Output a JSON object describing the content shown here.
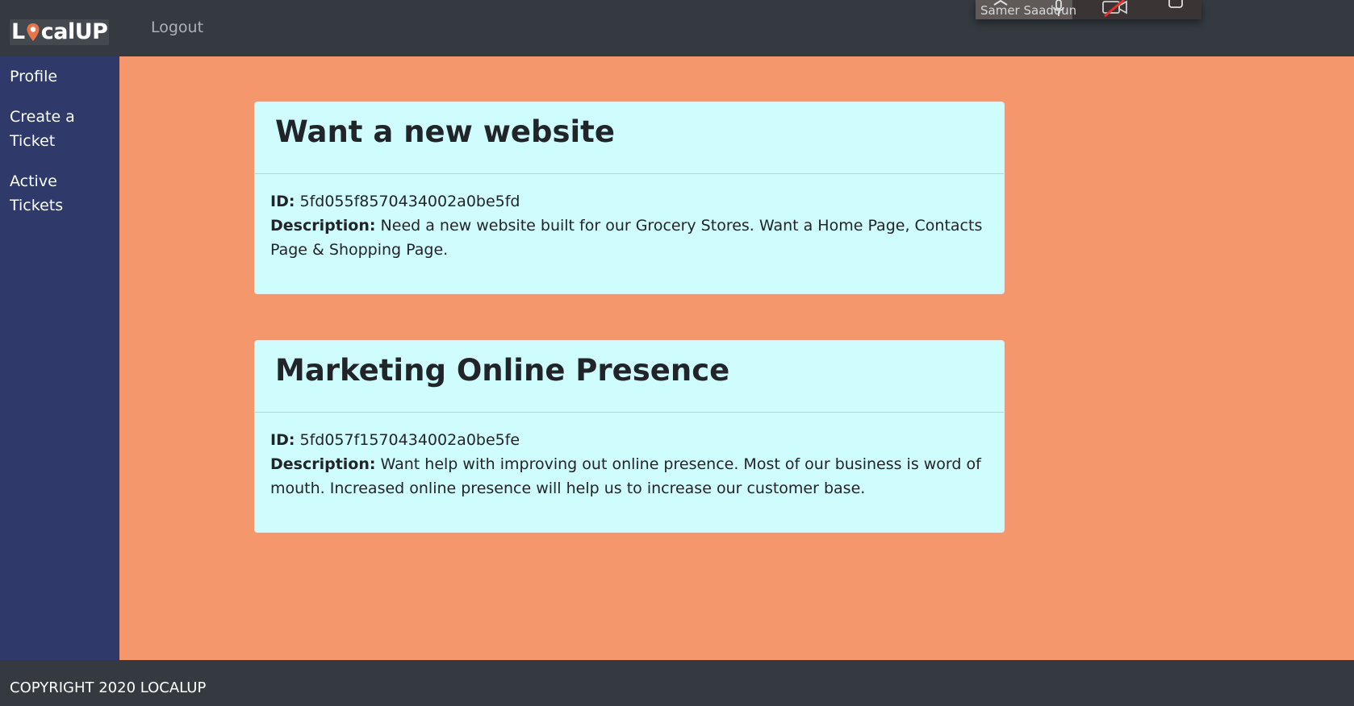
{
  "navbar": {
    "brand": "LocalUP",
    "logout_label": "Logout"
  },
  "video_overlay": {
    "participant_name": "Samer Saadoun"
  },
  "sidebar": {
    "items": [
      {
        "label": "Profile"
      },
      {
        "label": "Create a Ticket"
      },
      {
        "label": "Active Tickets"
      }
    ]
  },
  "tickets": [
    {
      "title": "Want a new website",
      "id_label": "ID:",
      "id": "5fd055f8570434002a0be5fd",
      "description_label": "Description:",
      "description": "Need a new website built for our Grocery Stores. Want a Home Page, Contacts Page & Shopping Page."
    },
    {
      "title": "Marketing Online Presence",
      "id_label": "ID:",
      "id": "5fd057f1570434002a0be5fe",
      "description_label": "Description:",
      "description": "Want help with improving out online presence. Most of our business is word of mouth. Increased online presence will help us to increase our customer base."
    }
  ],
  "footer": {
    "copyright": "COPYRIGHT 2020 LOCALUP"
  },
  "colors": {
    "navbar": "#343a40",
    "sidebar": "#2f3a6b",
    "main_background": "#f4976c",
    "card_background": "#cffcfc",
    "footer": "#343a40"
  }
}
